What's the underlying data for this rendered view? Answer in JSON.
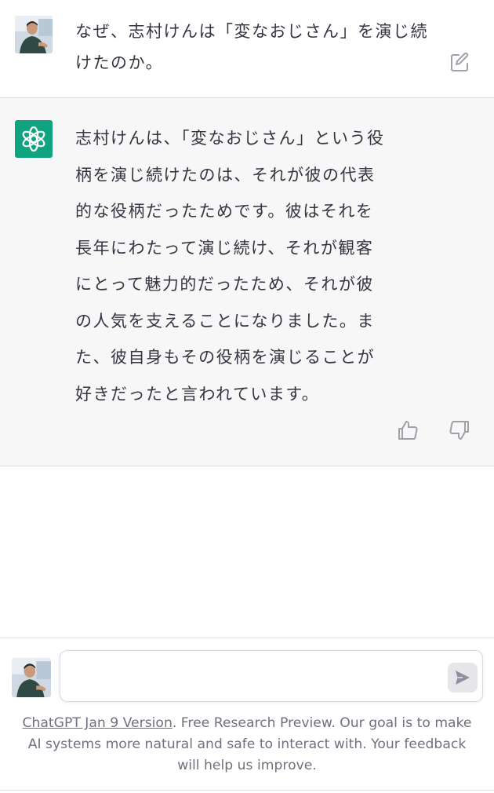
{
  "user_message": {
    "avatar_icon": "user-photo-avatar",
    "text": "なぜ、志村けんは「変なおじさん」を演じ続けたのか。",
    "edit_icon": "edit-icon"
  },
  "assistant_message": {
    "avatar_icon": "openai-logo-icon",
    "avatar_color": "#10a37f",
    "text": "志村けんは、「変なおじさん」という役柄を演じ続けたのは、それが彼の代表的な役柄だったためです。彼はそれを長年にわたって演じ続け、それが観客にとって魅力的だったため、それが彼の人気を支えることになりました。また、彼自身もその役柄を演じることが好きだったと言われています。",
    "feedback_icons": [
      "thumbs-up-icon",
      "thumbs-down-icon"
    ]
  },
  "composer": {
    "avatar_icon": "user-photo-avatar",
    "placeholder": "",
    "value": "",
    "send_icon": "send-icon"
  },
  "footer": {
    "version_link": "ChatGPT Jan 9 Version",
    "text": ". Free Research Preview. Our goal is to make AI systems more natural and safe to interact with. Your feedback will help us improve."
  }
}
